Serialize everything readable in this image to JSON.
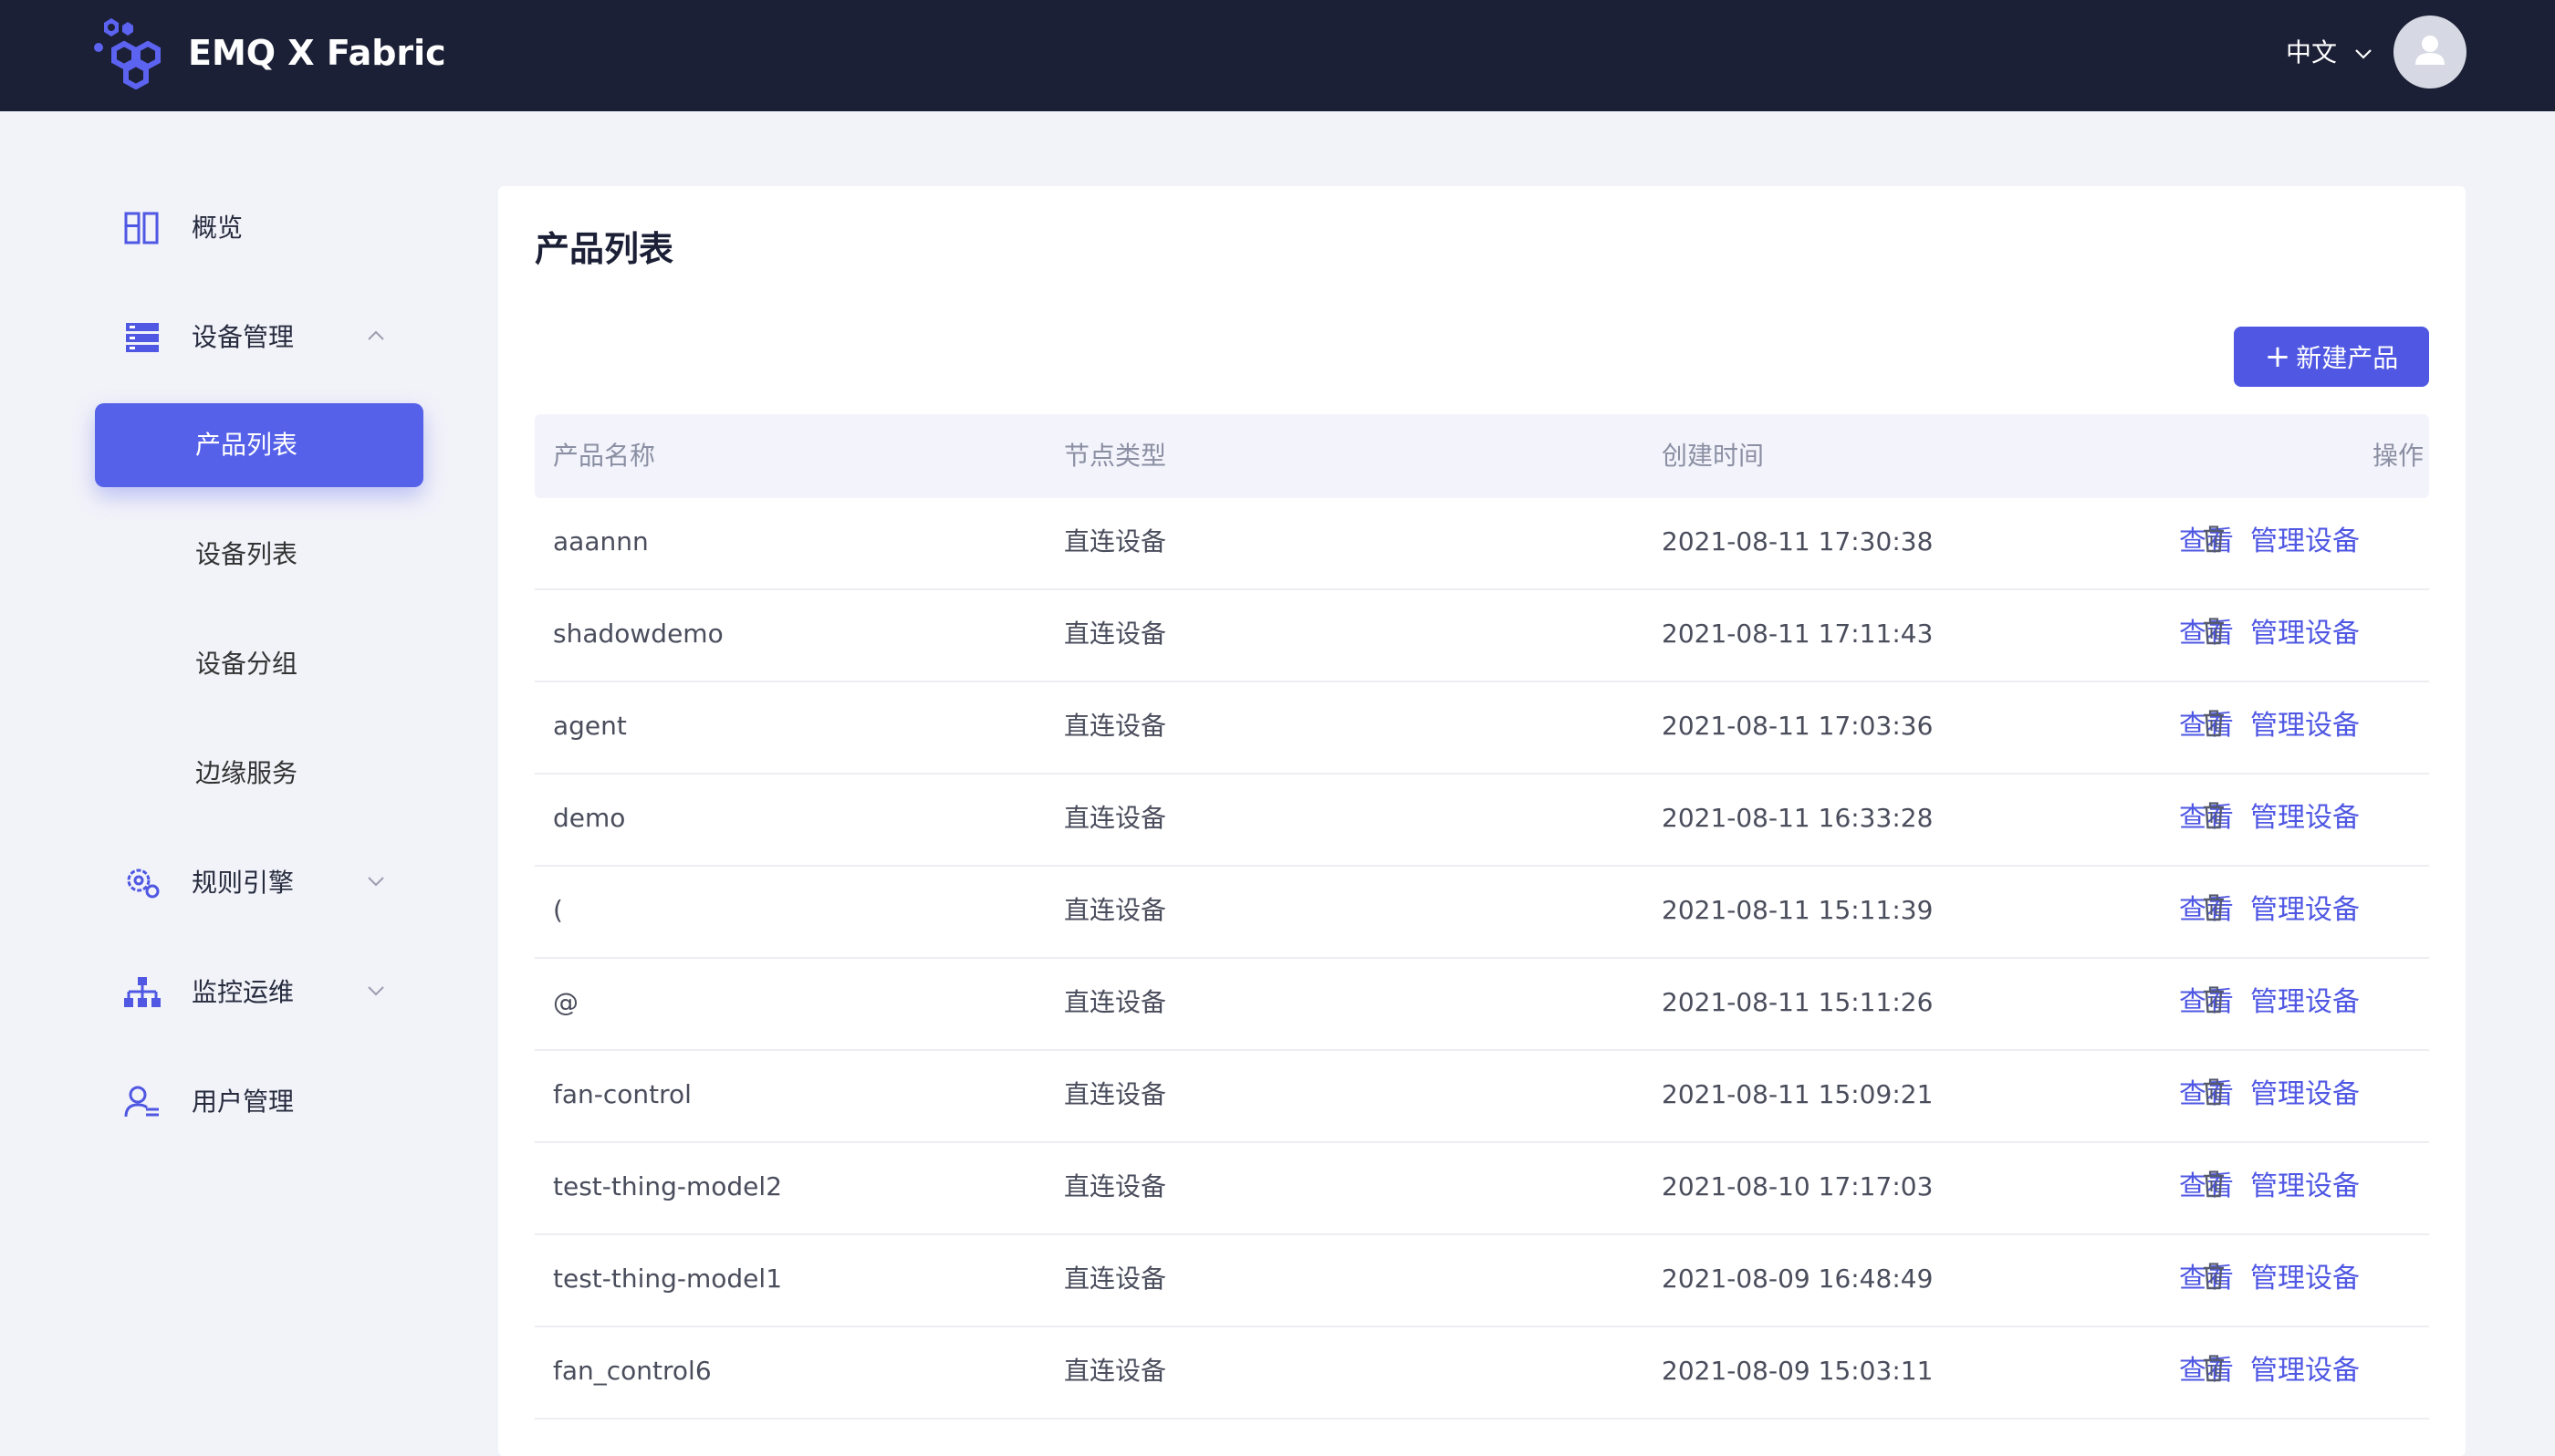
{
  "header": {
    "brand": "EMQ X Fabric",
    "language": "中文"
  },
  "sidebar": {
    "items": [
      {
        "label": "概览",
        "icon": "dashboard-icon"
      },
      {
        "label": "设备管理",
        "icon": "device-management-icon"
      },
      {
        "label": "规则引擎",
        "icon": "rule-engine-gear-icon"
      },
      {
        "label": "监控运维",
        "icon": "org-chart-icon"
      },
      {
        "label": "用户管理",
        "icon": "user-management-icon"
      }
    ],
    "sub_items": [
      {
        "label": "产品列表",
        "active": true
      },
      {
        "label": "设备列表"
      },
      {
        "label": "设备分组"
      },
      {
        "label": "边缘服务"
      }
    ]
  },
  "main": {
    "title": "产品列表",
    "new_button": "新建产品",
    "columns": [
      "产品名称",
      "节点类型",
      "创建时间",
      "操作"
    ],
    "actions": {
      "view": "查看",
      "manage": "管理设备"
    },
    "rows": [
      {
        "name": "aaannn",
        "type": "直连设备",
        "created": "2021-08-11 17:30:38"
      },
      {
        "name": "shadowdemo",
        "type": "直连设备",
        "created": "2021-08-11 17:11:43"
      },
      {
        "name": "agent",
        "type": "直连设备",
        "created": "2021-08-11 17:03:36"
      },
      {
        "name": "demo",
        "type": "直连设备",
        "created": "2021-08-11 16:33:28"
      },
      {
        "name": "(",
        "type": "直连设备",
        "created": "2021-08-11 15:11:39"
      },
      {
        "name": "@",
        "type": "直连设备",
        "created": "2021-08-11 15:11:26"
      },
      {
        "name": "fan-control",
        "type": "直连设备",
        "created": "2021-08-11 15:09:21"
      },
      {
        "name": "test-thing-model2",
        "type": "直连设备",
        "created": "2021-08-10 17:17:03"
      },
      {
        "name": "test-thing-model1",
        "type": "直连设备",
        "created": "2021-08-09 16:48:49"
      },
      {
        "name": "fan_control6",
        "type": "直连设备",
        "created": "2021-08-09 15:03:11"
      }
    ]
  },
  "colors": {
    "header_bg": "#1c2036",
    "accent": "#4f57e3",
    "page_bg": "#f2f3f9"
  }
}
